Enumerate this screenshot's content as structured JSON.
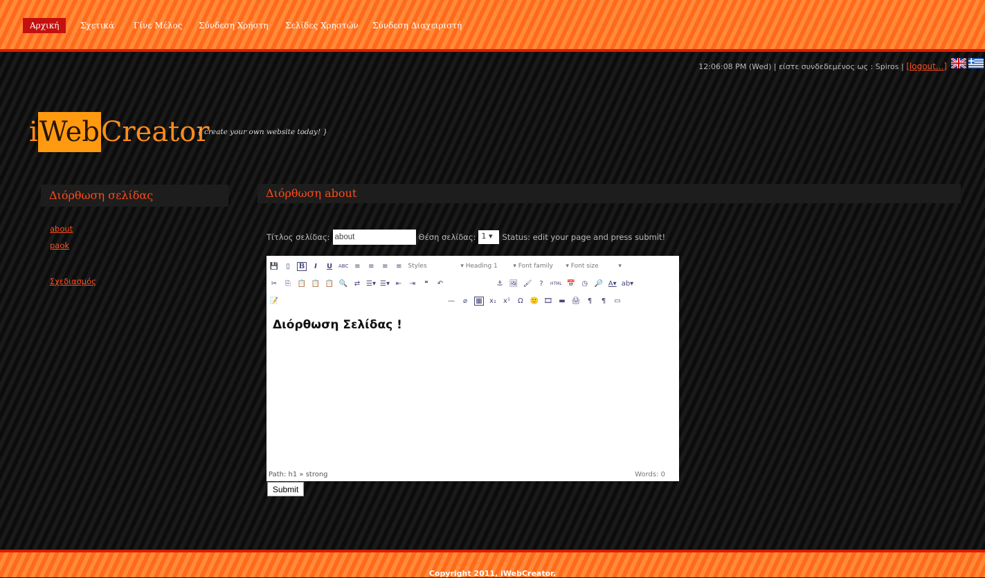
{
  "nav": [
    {
      "label": "Αρχική",
      "active": true
    },
    {
      "label": "Σχετικά"
    },
    {
      "label": "Γίνε Μέλος"
    },
    {
      "label": "Σύνδεση Χρήστη"
    },
    {
      "label": "Σελίδες Χρηστών"
    },
    {
      "label": "Σύνδεση Διαχειριστή"
    }
  ],
  "status": {
    "text": "12:06:08 PM (Wed) | είστε συνδεδεμένος ως : Spiros |",
    "logout": "[logout...]"
  },
  "logo": {
    "i": "i",
    "web": "Web",
    "creator": "Creator",
    "tagline": "{ create your own website today! }"
  },
  "sidebar": {
    "title": "Διόρθωση σελίδας",
    "links": [
      "about",
      "paok",
      "Σχεδιασμός"
    ]
  },
  "main": {
    "title": "Διόρθωση about",
    "title_label": "Τίτλος σελίδας:",
    "title_value": "about",
    "position_label": "Θέση σελίδας:",
    "position_value": "1",
    "status": "Status: edit your page and press submit!"
  },
  "editor": {
    "styles": "Styles",
    "heading": "Heading 1",
    "font_family": "Font family",
    "font_size": "Font size",
    "content": "Διόρθωση Σελίδας !",
    "path": "Path: h1 » strong",
    "words": "Words: 0",
    "html_icon": "HTML"
  },
  "submit": "Submit",
  "footer": "Copyright 2011, iWebCreator.",
  "colors": {
    "accent": "#ff4a1a",
    "nav_active": "#c5100e",
    "logo_box": "#ff9a10"
  }
}
